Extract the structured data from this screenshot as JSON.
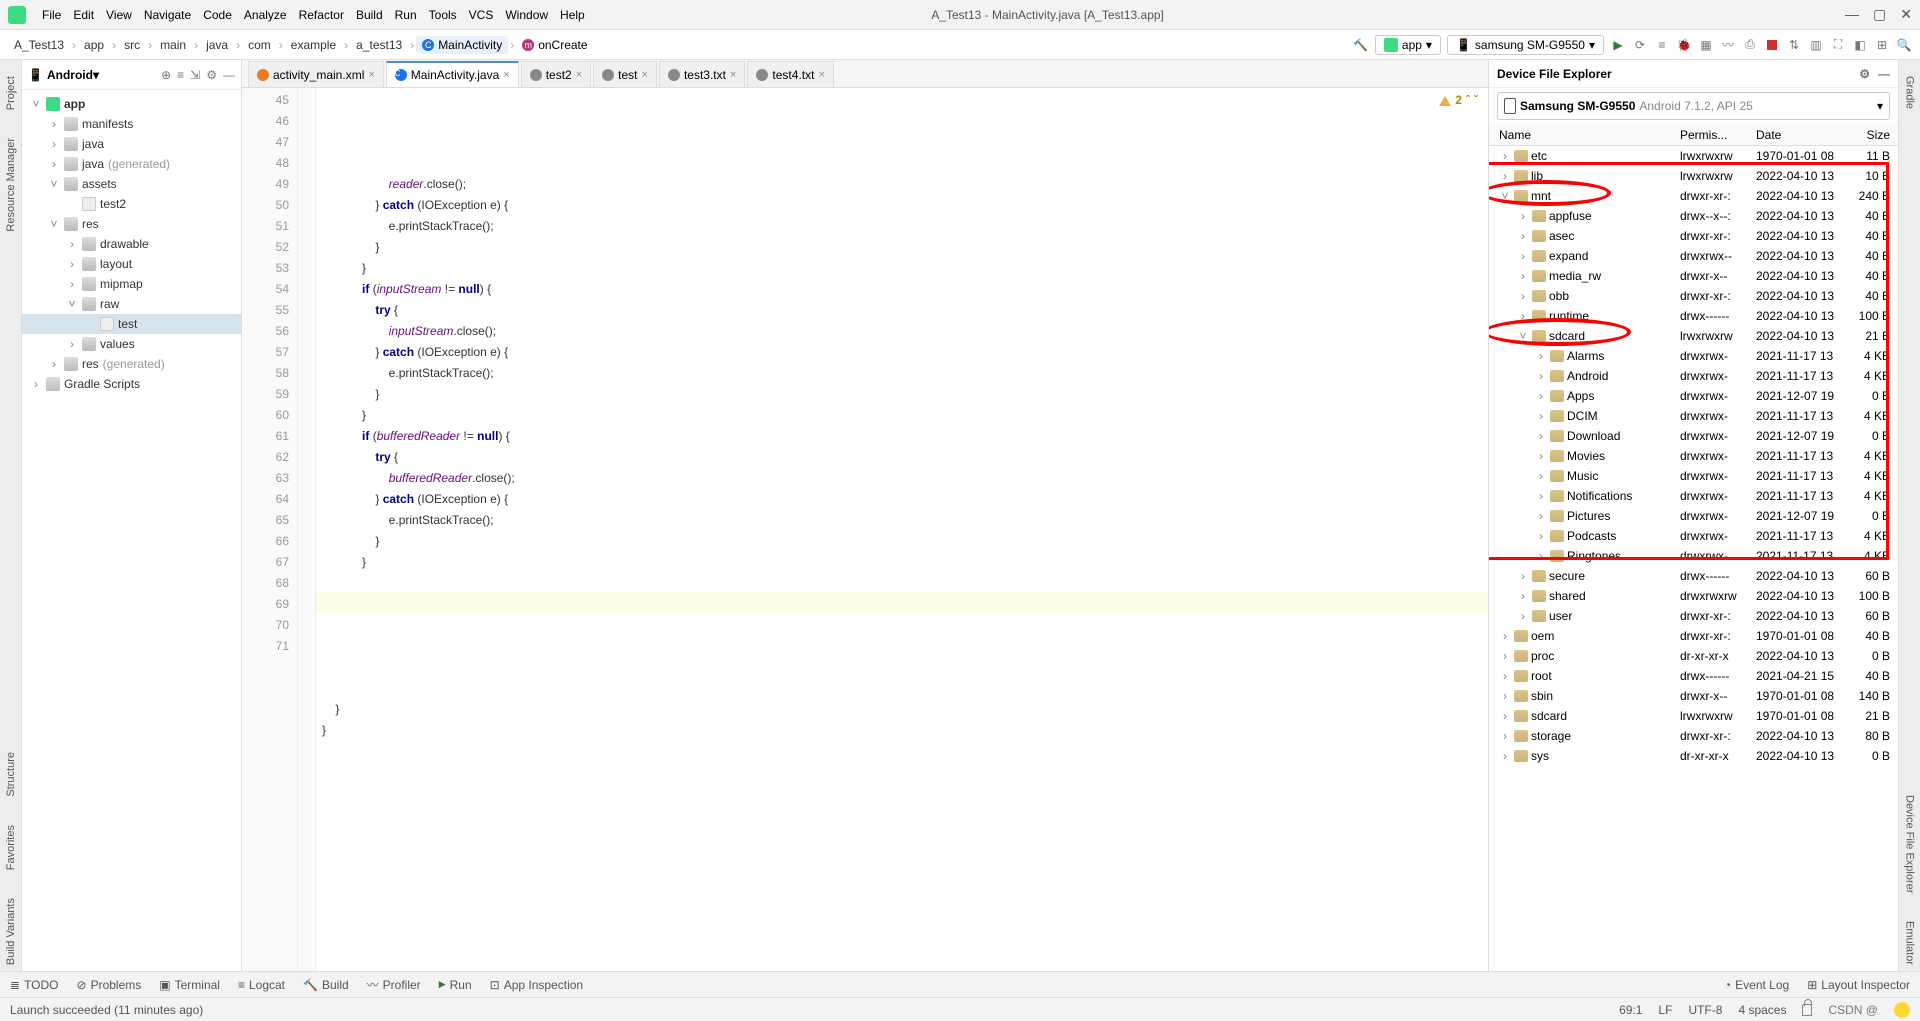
{
  "window": {
    "title": "A_Test13 - MainActivity.java [A_Test13.app]"
  },
  "menu": {
    "file": "File",
    "edit": "Edit",
    "view": "View",
    "navigate": "Navigate",
    "code": "Code",
    "analyze": "Analyze",
    "refactor": "Refactor",
    "build": "Build",
    "run": "Run",
    "tools": "Tools",
    "vcs": "VCS",
    "window": "Window",
    "help": "Help"
  },
  "breadcrumb": {
    "items": [
      "A_Test13",
      "app",
      "src",
      "main",
      "java",
      "com",
      "example",
      "a_test13"
    ],
    "class": "MainActivity",
    "method": "onCreate"
  },
  "runConfig": {
    "label": "app"
  },
  "deviceSelector": {
    "label": "samsung SM-G9550"
  },
  "projectView": {
    "label": "Android"
  },
  "projectTree": [
    {
      "l": "app",
      "d": 0,
      "exp": "v",
      "icon": "mod",
      "bold": true
    },
    {
      "l": "manifests",
      "d": 1,
      "exp": ">",
      "icon": "fold"
    },
    {
      "l": "java",
      "d": 1,
      "exp": ">",
      "icon": "fold"
    },
    {
      "l": "java",
      "suffix": " (generated)",
      "d": 1,
      "exp": ">",
      "icon": "fold"
    },
    {
      "l": "assets",
      "d": 1,
      "exp": "v",
      "icon": "fold"
    },
    {
      "l": "test2",
      "d": 2,
      "exp": "",
      "icon": "file"
    },
    {
      "l": "res",
      "d": 1,
      "exp": "v",
      "icon": "fold"
    },
    {
      "l": "drawable",
      "d": 2,
      "exp": ">",
      "icon": "fold"
    },
    {
      "l": "layout",
      "d": 2,
      "exp": ">",
      "icon": "fold"
    },
    {
      "l": "mipmap",
      "d": 2,
      "exp": ">",
      "icon": "fold"
    },
    {
      "l": "raw",
      "d": 2,
      "exp": "v",
      "icon": "fold"
    },
    {
      "l": "test",
      "d": 3,
      "exp": "",
      "icon": "file",
      "sel": true
    },
    {
      "l": "values",
      "d": 2,
      "exp": ">",
      "icon": "fold"
    },
    {
      "l": "res",
      "suffix": " (generated)",
      "d": 1,
      "exp": ">",
      "icon": "fold"
    },
    {
      "l": "Gradle Scripts",
      "d": 0,
      "exp": ">",
      "icon": "gradle"
    }
  ],
  "editorTabs": [
    {
      "label": "activity_main.xml",
      "icon": "xml"
    },
    {
      "label": "MainActivity.java",
      "icon": "java",
      "active": true
    },
    {
      "label": "test2",
      "icon": "txt"
    },
    {
      "label": "test",
      "icon": "txt"
    },
    {
      "label": "test3.txt",
      "icon": "txt"
    },
    {
      "label": "test4.txt",
      "icon": "txt"
    }
  ],
  "editorWarning": {
    "count": "2"
  },
  "code": {
    "firstLine": 45,
    "lines": [
      "                    reader.close();",
      "                } catch (IOException e) {",
      "                    e.printStackTrace();",
      "                }",
      "            }",
      "            if (inputStream != null) {",
      "                try {",
      "                    inputStream.close();",
      "                } catch (IOException e) {",
      "                    e.printStackTrace();",
      "                }",
      "            }",
      "            if (bufferedReader != null) {",
      "                try {",
      "                    bufferedReader.close();",
      "                } catch (IOException e) {",
      "                    e.printStackTrace();",
      "                }",
      "            }",
      "",
      "        }",
      "",
      "",
      "",
      "",
      "    }",
      "}"
    ]
  },
  "dfe": {
    "title": "Device File Explorer",
    "device": {
      "name": "Samsung SM-G9550",
      "detail": "Android 7.1.2, API 25"
    },
    "cols": {
      "name": "Name",
      "perm": "Permis...",
      "date": "Date",
      "size": "Size"
    },
    "rows": [
      {
        "d": 0,
        "exp": ">",
        "n": "etc",
        "p": "lrwxrwxrw",
        "t": "1970-01-01 08",
        "s": "11 B"
      },
      {
        "d": 0,
        "exp": ">",
        "n": "lib",
        "p": "lrwxrwxrw",
        "t": "2022-04-10 13",
        "s": "10 B"
      },
      {
        "d": 0,
        "exp": "v",
        "n": "mnt",
        "p": "drwxr-xr-:",
        "t": "2022-04-10 13",
        "s": "240 B"
      },
      {
        "d": 1,
        "exp": ">",
        "n": "appfuse",
        "p": "drwx--x--:",
        "t": "2022-04-10 13",
        "s": "40 B"
      },
      {
        "d": 1,
        "exp": ">",
        "n": "asec",
        "p": "drwxr-xr-:",
        "t": "2022-04-10 13",
        "s": "40 B"
      },
      {
        "d": 1,
        "exp": ">",
        "n": "expand",
        "p": "drwxrwx--",
        "t": "2022-04-10 13",
        "s": "40 B"
      },
      {
        "d": 1,
        "exp": ">",
        "n": "media_rw",
        "p": "drwxr-x--",
        "t": "2022-04-10 13",
        "s": "40 B"
      },
      {
        "d": 1,
        "exp": ">",
        "n": "obb",
        "p": "drwxr-xr-:",
        "t": "2022-04-10 13",
        "s": "40 B"
      },
      {
        "d": 1,
        "exp": ">",
        "n": "runtime",
        "p": "drwx------",
        "t": "2022-04-10 13",
        "s": "100 B"
      },
      {
        "d": 1,
        "exp": "v",
        "n": "sdcard",
        "p": "lrwxrwxrw",
        "t": "2022-04-10 13",
        "s": "21 B"
      },
      {
        "d": 2,
        "exp": ">",
        "n": "Alarms",
        "p": "drwxrwx-",
        "t": "2021-11-17 13",
        "s": "4 KB"
      },
      {
        "d": 2,
        "exp": ">",
        "n": "Android",
        "p": "drwxrwx-",
        "t": "2021-11-17 13",
        "s": "4 KB"
      },
      {
        "d": 2,
        "exp": ">",
        "n": "Apps",
        "p": "drwxrwx-",
        "t": "2021-12-07 19",
        "s": "0 B"
      },
      {
        "d": 2,
        "exp": ">",
        "n": "DCIM",
        "p": "drwxrwx-",
        "t": "2021-11-17 13",
        "s": "4 KB"
      },
      {
        "d": 2,
        "exp": ">",
        "n": "Download",
        "p": "drwxrwx-",
        "t": "2021-12-07 19",
        "s": "0 B"
      },
      {
        "d": 2,
        "exp": ">",
        "n": "Movies",
        "p": "drwxrwx-",
        "t": "2021-11-17 13",
        "s": "4 KB"
      },
      {
        "d": 2,
        "exp": ">",
        "n": "Music",
        "p": "drwxrwx-",
        "t": "2021-11-17 13",
        "s": "4 KB"
      },
      {
        "d": 2,
        "exp": ">",
        "n": "Notifications",
        "p": "drwxrwx-",
        "t": "2021-11-17 13",
        "s": "4 KB"
      },
      {
        "d": 2,
        "exp": ">",
        "n": "Pictures",
        "p": "drwxrwx-",
        "t": "2021-12-07 19",
        "s": "0 B"
      },
      {
        "d": 2,
        "exp": ">",
        "n": "Podcasts",
        "p": "drwxrwx-",
        "t": "2021-11-17 13",
        "s": "4 KB"
      },
      {
        "d": 2,
        "exp": ">",
        "n": "Ringtones",
        "p": "drwxrwx-",
        "t": "2021-11-17 13",
        "s": "4 KB"
      },
      {
        "d": 1,
        "exp": ">",
        "n": "secure",
        "p": "drwx------",
        "t": "2022-04-10 13",
        "s": "60 B"
      },
      {
        "d": 1,
        "exp": ">",
        "n": "shared",
        "p": "drwxrwxrw",
        "t": "2022-04-10 13",
        "s": "100 B"
      },
      {
        "d": 1,
        "exp": ">",
        "n": "user",
        "p": "drwxr-xr-:",
        "t": "2022-04-10 13",
        "s": "60 B"
      },
      {
        "d": 0,
        "exp": ">",
        "n": "oem",
        "p": "drwxr-xr-:",
        "t": "1970-01-01 08",
        "s": "40 B"
      },
      {
        "d": 0,
        "exp": ">",
        "n": "proc",
        "p": "dr-xr-xr-x",
        "t": "2022-04-10 13",
        "s": "0 B"
      },
      {
        "d": 0,
        "exp": ">",
        "n": "root",
        "p": "drwx------",
        "t": "2021-04-21 15",
        "s": "40 B"
      },
      {
        "d": 0,
        "exp": ">",
        "n": "sbin",
        "p": "drwxr-x--",
        "t": "1970-01-01 08",
        "s": "140 B"
      },
      {
        "d": 0,
        "exp": ">",
        "n": "sdcard",
        "p": "lrwxrwxrw",
        "t": "1970-01-01 08",
        "s": "21 B"
      },
      {
        "d": 0,
        "exp": ">",
        "n": "storage",
        "p": "drwxr-xr-:",
        "t": "2022-04-10 13",
        "s": "80 B"
      },
      {
        "d": 0,
        "exp": ">",
        "n": "sys",
        "p": "dr-xr-xr-x",
        "t": "2022-04-10 13",
        "s": "0 B"
      }
    ]
  },
  "bottomTools": {
    "todo": "TODO",
    "problems": "Problems",
    "terminal": "Terminal",
    "logcat": "Logcat",
    "build": "Build",
    "profiler": "Profiler",
    "run": "Run",
    "appInspection": "App Inspection",
    "eventLog": "Event Log",
    "layoutInspector": "Layout Inspector"
  },
  "status": {
    "msg": "Launch succeeded (11 minutes ago)",
    "caret": "69:1",
    "le": "LF",
    "enc": "UTF-8",
    "indent": "4 spaces"
  },
  "sideTabs": {
    "project": "Project",
    "resmgr": "Resource Manager",
    "structure": "Structure",
    "favorites": "Favorites",
    "buildVariants": "Build Variants",
    "gradle": "Gradle",
    "emulator": "Emulator",
    "dfe": "Device File Explorer"
  }
}
